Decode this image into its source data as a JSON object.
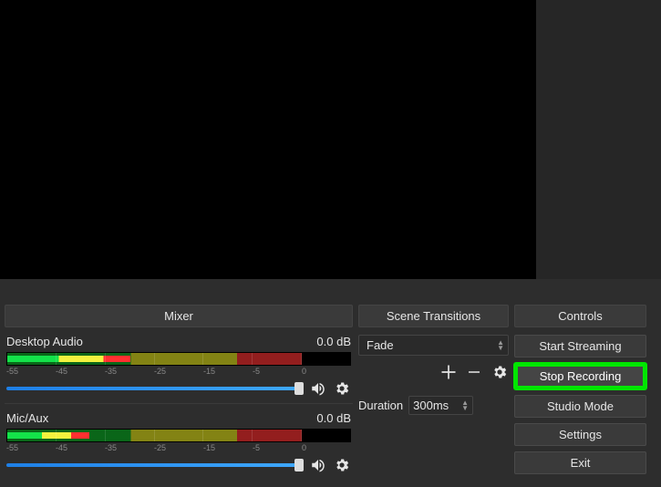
{
  "preview": {},
  "mixer": {
    "header": "Mixer",
    "items": [
      {
        "name": "Desktop Audio",
        "level": "0.0 dB",
        "ticks": [
          "-55",
          "-45",
          "-35",
          "-25",
          "-15",
          "-5",
          "0"
        ]
      },
      {
        "name": "Mic/Aux",
        "level": "0.0 dB",
        "ticks": [
          "-55",
          "-45",
          "-35",
          "-25",
          "-15",
          "-5",
          "0"
        ]
      }
    ]
  },
  "transitions": {
    "header": "Scene Transitions",
    "selected": "Fade",
    "duration_label": "Duration",
    "duration_value": "300ms"
  },
  "controls": {
    "header": "Controls",
    "buttons": {
      "start_streaming": "Start Streaming",
      "stop_recording": "Stop Recording",
      "studio_mode": "Studio Mode",
      "settings": "Settings",
      "exit": "Exit"
    }
  },
  "icons": {
    "plus": "plus-icon",
    "minus": "minus-icon",
    "gear": "gear-icon",
    "speaker": "speaker-icon"
  }
}
